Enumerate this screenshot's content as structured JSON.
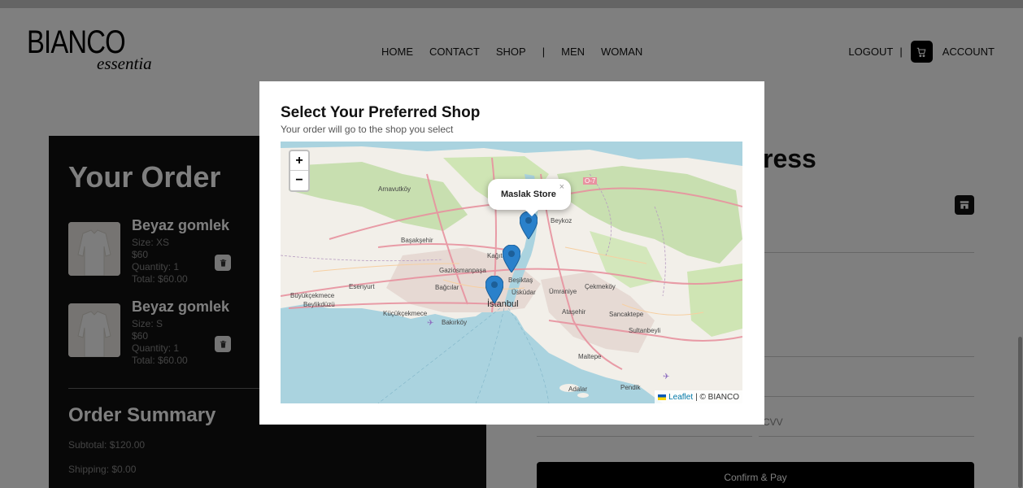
{
  "header": {
    "logo_main": "BIANCO",
    "logo_sub": "essentia",
    "nav": [
      "HOME",
      "CONTACT",
      "SHOP",
      "|",
      "MEN",
      "WOMAN"
    ],
    "logout": "LOGOUT",
    "pipe": "|",
    "account": "ACCOUNT"
  },
  "order": {
    "title": "Your Order",
    "items": [
      {
        "name": "Beyaz gomlek",
        "size": "Size: XS",
        "price": "$60",
        "quantity": "Quantity: 1",
        "total": "Total: $60.00"
      },
      {
        "name": "Beyaz gomlek",
        "size": "Size: S",
        "price": "$60",
        "quantity": "Quantity: 1",
        "total": "Total: $60.00"
      }
    ],
    "summary_title": "Order Summary",
    "subtotal": "Subtotal: $120.00",
    "shipping": "Shipping: $0.00"
  },
  "address": {
    "title_partial": "ress",
    "cvv_label": "CVV",
    "confirm_label": "Confirm & Pay"
  },
  "modal": {
    "title": "Select Your Preferred Shop",
    "subtitle": "Your order will go to the shop you select",
    "zoom_in": "+",
    "zoom_out": "−",
    "popup_text": "Maslak Store",
    "popup_close": "×",
    "attribution_link": "Leaflet",
    "attribution_rest": "| © BIANCO",
    "map_labels": {
      "istanbul": "İstanbul",
      "arnavutkoy": "Arnavutköy",
      "basaksehir": "Başakşehir",
      "esenyurt": "Esenyurt",
      "bagcilar": "Bağcılar",
      "buyukcekmece": "Büyükçekmece",
      "beylikduzu": "Beylikdüzü",
      "kucukcekmece": "Küçükçekmece",
      "bakirkoy": "Bakırköy",
      "kagithane": "Kağıt",
      "gaziosmanpasa": "Gaziosmanpaşa",
      "besiktas": "Beşiktaş",
      "uskudar": "Üsküdar",
      "umraniye": "Ümraniye",
      "cekmekoy": "Çekmeköy",
      "beykoz": "Beykoz",
      "atasehir": "Ataşehir",
      "sancaktepe": "Sancaktepe",
      "sultanbeyli": "Sultanbeyli",
      "maltepe": "Maltepe",
      "pendik": "Pendik",
      "adalar": "Adalar",
      "o7": "O-7"
    }
  }
}
